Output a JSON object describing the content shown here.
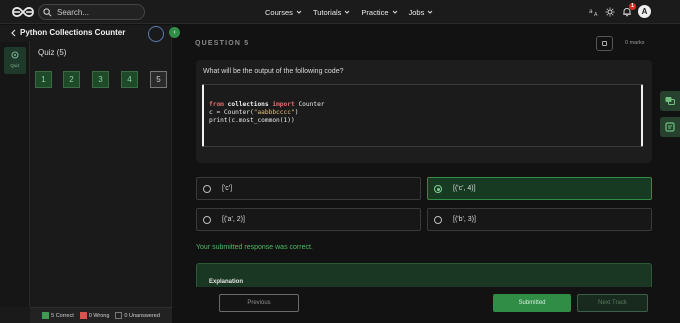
{
  "nav": {
    "search_placeholder": "Search...",
    "menu": [
      "Courses",
      "Tutorials",
      "Practice",
      "Jobs"
    ],
    "notification_count": "1",
    "avatar_initial": "A"
  },
  "sidebar": {
    "course_title": "Python Collections Counter",
    "rail_tab_label": "Quiz",
    "quiz_title": "Quiz (5)",
    "questions": [
      "1",
      "2",
      "3",
      "4",
      "5"
    ],
    "legend": {
      "correct": "5 Correct",
      "wrong": "0 Wrong",
      "unanswered": "0 Unanswered"
    }
  },
  "question": {
    "label": "QUESTION 5",
    "marks": "0 marks",
    "text": "What will be the output of the following code?",
    "code": {
      "kw_from": "from",
      "module": "collections",
      "kw_import": "import",
      "name": "Counter",
      "line2_pre": "c = Counter(",
      "line2_str": "\"aabbbcccc\"",
      "line2_post": ")",
      "line3": "print(c.most_common(1))"
    },
    "options": [
      "['c']",
      "[('c', 4)]",
      "[('a', 2)]",
      "[('b', 3)]"
    ],
    "selected_index": 1
  },
  "feedback": "Your submitted response was correct.",
  "explanation_title": "Explanation",
  "footer": {
    "previous": "Previous",
    "submitted": "Submitted",
    "next": "Next Track"
  },
  "colors": {
    "accent": "#2f8d46",
    "correct": "#2f8d46",
    "wrong": "#d9534f",
    "unanswered": "#555555"
  }
}
